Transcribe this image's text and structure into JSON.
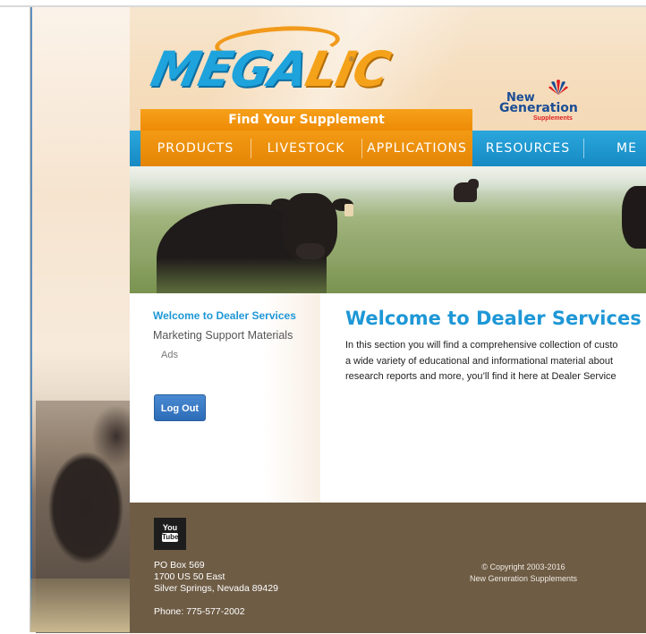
{
  "header": {
    "logo": {
      "part1": "MEGA",
      "part2": "LIC",
      "tm": "®"
    },
    "partner_logo": {
      "line1": "New",
      "line2": "Generation",
      "line3": "Supplements"
    },
    "find_supplement": "Find Your Supplement"
  },
  "nav": {
    "items": [
      {
        "label": "PRODUCTS"
      },
      {
        "label": "LIVESTOCK"
      },
      {
        "label": "APPLICATIONS"
      },
      {
        "label": "RESOURCES"
      },
      {
        "label": "ME"
      }
    ]
  },
  "sidebar": {
    "active_link": "Welcome to Dealer Services",
    "link": "Marketing Support Materials",
    "sub_link": "Ads",
    "logout_label": "Log Out"
  },
  "main": {
    "title": "Welcome to Dealer Services",
    "body_lines": [
      "In this section you will find a comprehensive collection of custo",
      "a wide variety of educational and informational material about",
      "research reports and more, you’ll find it here at Dealer Service"
    ]
  },
  "footer": {
    "youtube": {
      "you": "You",
      "tube": "Tube"
    },
    "address": [
      "PO Box 569",
      "1700 US 50 East",
      "Silver Springs, Nevada 89429"
    ],
    "phone": "Phone: 775-577-2002",
    "copyright": [
      "© Copyright 2003-2016",
      "New Generation Supplements"
    ]
  },
  "colors": {
    "brand_blue": "#1e97d6",
    "nav_orange": "#f39a14",
    "footer_brown": "#6e5c45",
    "logout_blue": "#3a7bc8"
  }
}
